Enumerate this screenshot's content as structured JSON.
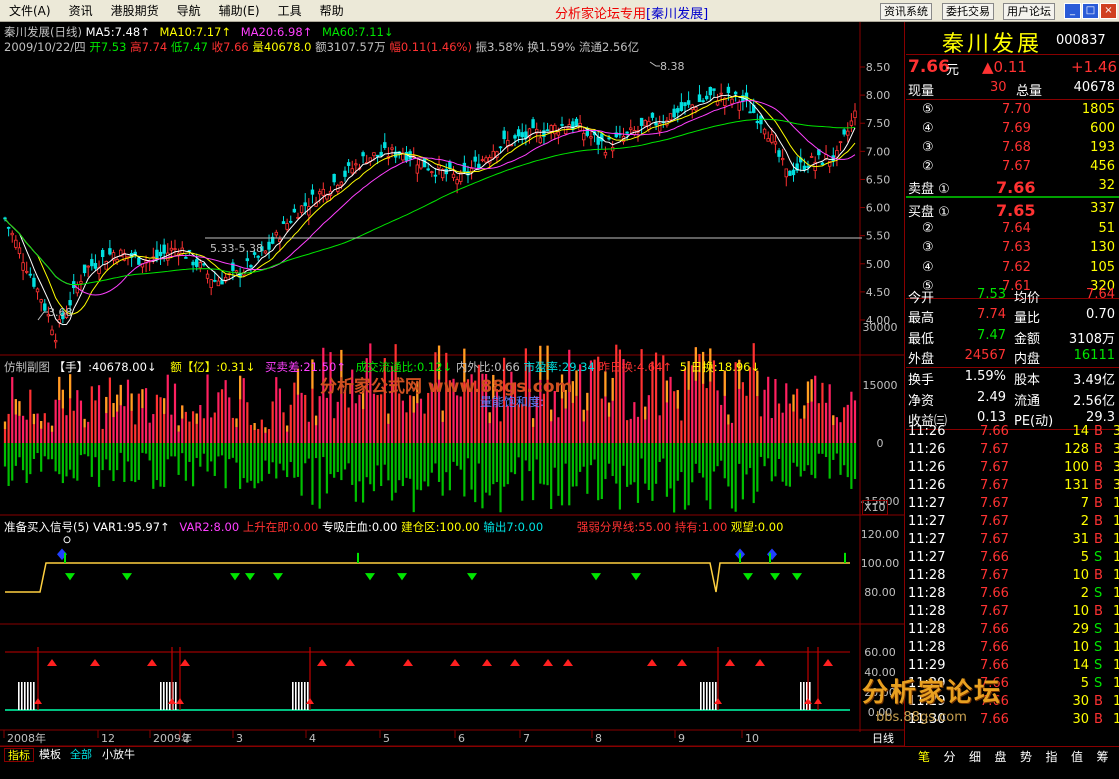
{
  "menu": {
    "items": [
      "文件(A)",
      "资讯",
      "港股期货",
      "导航",
      "辅助(E)",
      "工具",
      "帮助"
    ],
    "title": "分析家论坛专用",
    "title_stock": "[秦川发展]",
    "right_buttons": [
      "资讯系统",
      "委托交易",
      "用户论坛"
    ],
    "window_btns": [
      "_",
      "□",
      "×"
    ]
  },
  "main": {
    "line1": [
      "秦川发展(日线)",
      "MA5:7.48↑",
      "MA10:7.17↑",
      "MA20:6.98↑",
      "MA60:7.11↓"
    ],
    "line2": {
      "date": "2009/10/22/四",
      "open": "开7.53",
      "high": "高7.74",
      "low": "低7.47",
      "close": "收7.66",
      "vol": "量40678.0",
      "amt": "额3107.57万",
      "chg": "幅0.11(1.46%)",
      "amp": "振3.58%",
      "turn": "换1.59%",
      "float": "流通2.56亿"
    },
    "annot_high": "8.38",
    "annot_low": "3.68",
    "annot_range": "5.33-5.38",
    "yticks": [
      "8.50",
      "8.00",
      "7.50",
      "7.00",
      "6.50",
      "6.00",
      "5.50",
      "5.00",
      "4.50",
      "4.00"
    ]
  },
  "sub1": {
    "label": "仿制副图",
    "items": [
      "【手】:40678.00↓",
      "额【亿】:0.31↓",
      "买卖差:21.50↑",
      "成交流通比:0.12↓",
      "内外比:0.66",
      "市盈率:29.34",
      "昨日换:4.64↑",
      "5 日换:18.96↓"
    ],
    "overlay": "分析家公式网 www.88gs.com",
    "overlay2": "量能饱和度:",
    "yticks": [
      "30000",
      "15000",
      "0",
      "-15000"
    ],
    "x10": "X10"
  },
  "sub2": {
    "items": [
      "准备买入信号(5)",
      "VAR1:95.97↑",
      "VAR2:8.00",
      "上升在即:0.00",
      "专吸庄血:0.00",
      "建仓区:100.00",
      "输出7:0.00",
      "强弱分界线:55.00",
      "持有:1.00",
      "观望:0.00"
    ],
    "yticks": [
      "120.00",
      "100.00",
      "80.00"
    ]
  },
  "sub3": {
    "yticks": [
      "60.00",
      "40.00",
      "20.00",
      "0.00"
    ]
  },
  "xaxis": {
    "labels": [
      "2008年",
      "12",
      "2009年",
      "2",
      "3",
      "4",
      "5",
      "6",
      "7",
      "8",
      "9",
      "10"
    ],
    "period": "日线"
  },
  "bottom": {
    "tabs": [
      "指标",
      "模板",
      "全部",
      "小放牛"
    ],
    "right_icons": [
      "笔",
      "分",
      "细",
      "盘",
      "势",
      "指",
      "值",
      "筹"
    ]
  },
  "watermark": {
    "text": "分析家论坛",
    "url": "bbs.88gs.com"
  },
  "quote": {
    "name": "秦川发展",
    "code": "000837",
    "price": "7.66",
    "price_unit": "元",
    "change": "▲0.11",
    "change2": "+1.46",
    "xianliang_label": "现量",
    "xianliang": "30",
    "zongliang_label": "总量",
    "zongliang": "40678",
    "sells": [
      [
        "⑤",
        "7.70",
        "1805"
      ],
      [
        "④",
        "7.69",
        "600"
      ],
      [
        "③",
        "7.68",
        "193"
      ],
      [
        "②",
        "7.67",
        "456"
      ],
      [
        "卖盘 ①",
        "7.66",
        "32"
      ]
    ],
    "buys": [
      [
        "买盘 ①",
        "7.65",
        "337"
      ],
      [
        "②",
        "7.64",
        "51"
      ],
      [
        "③",
        "7.63",
        "130"
      ],
      [
        "④",
        "7.62",
        "105"
      ],
      [
        "⑤",
        "7.61",
        "320"
      ]
    ],
    "stats": [
      [
        "今开",
        "7.53",
        "均价",
        "7.64"
      ],
      [
        "最高",
        "7.74",
        "量比",
        "0.70"
      ],
      [
        "最低",
        "7.47",
        "金额",
        "3108万"
      ],
      [
        "外盘",
        "24567",
        "内盘",
        "16111"
      ],
      [
        "换手",
        "1.59%",
        "股本",
        "3.49亿"
      ],
      [
        "净资",
        "2.49",
        "流通",
        "2.56亿"
      ],
      [
        "收益㈢",
        "0.13",
        "PE(动)",
        "29.3"
      ]
    ],
    "ticks": [
      [
        "11:26",
        "7.66",
        "14",
        "B",
        "3"
      ],
      [
        "11:26",
        "7.67",
        "128",
        "B",
        "3"
      ],
      [
        "11:26",
        "7.67",
        "100",
        "B",
        "3"
      ],
      [
        "11:26",
        "7.67",
        "131",
        "B",
        "3"
      ],
      [
        "11:27",
        "7.67",
        "7",
        "B",
        "1"
      ],
      [
        "11:27",
        "7.67",
        "2",
        "B",
        "1"
      ],
      [
        "11:27",
        "7.67",
        "31",
        "B",
        "1"
      ],
      [
        "11:27",
        "7.66",
        "5",
        "S",
        "1"
      ],
      [
        "11:28",
        "7.67",
        "10",
        "B",
        "1"
      ],
      [
        "11:28",
        "7.66",
        "2",
        "S",
        "1"
      ],
      [
        "11:28",
        "7.67",
        "10",
        "B",
        "1"
      ],
      [
        "11:28",
        "7.66",
        "29",
        "S",
        "1"
      ],
      [
        "11:28",
        "7.66",
        "10",
        "S",
        "1"
      ],
      [
        "11:29",
        "7.66",
        "14",
        "S",
        "1"
      ],
      [
        "11:29",
        "7.66",
        "5",
        "S",
        "1"
      ],
      [
        "11:29",
        "7.66",
        "30",
        "B",
        "1"
      ],
      [
        "11:30",
        "7.66",
        "30",
        "B",
        "1"
      ]
    ]
  },
  "colors": {
    "up": "#ff3232",
    "down": "#00e600",
    "ma5": "#ffffff",
    "ma10": "#ffff00",
    "ma20": "#ff40ff",
    "ma60": "#00e600"
  }
}
